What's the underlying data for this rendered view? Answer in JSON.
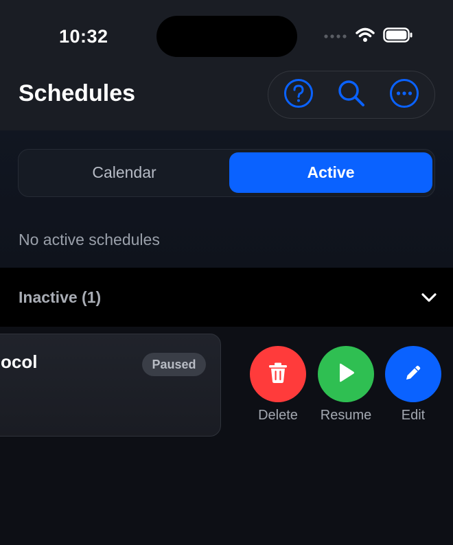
{
  "status_bar": {
    "time": "10:32",
    "icons": [
      "signal-icon",
      "wifi-icon",
      "battery-icon"
    ]
  },
  "header": {
    "title": "Schedules",
    "actions": [
      "help-icon",
      "search-icon",
      "more-icon"
    ]
  },
  "tabs": {
    "items": [
      "Calendar",
      "Active"
    ],
    "selected": "Active"
  },
  "active_section": {
    "empty_message": "No active schedules"
  },
  "inactive_section": {
    "label": "Inactive (1)",
    "expanded": true
  },
  "schedule_card": {
    "title_visible": "ocol",
    "status": "Paused"
  },
  "swipe_actions": [
    {
      "label": "Delete",
      "icon": "trash-icon",
      "color": "#ff3b3b"
    },
    {
      "label": "Resume",
      "icon": "play-icon",
      "color": "#2fbf52"
    },
    {
      "label": "Edit",
      "icon": "pencil-icon",
      "color": "#0a62ff"
    }
  ],
  "colors": {
    "accent": "#0a62ff",
    "background": "#0d0f15"
  }
}
